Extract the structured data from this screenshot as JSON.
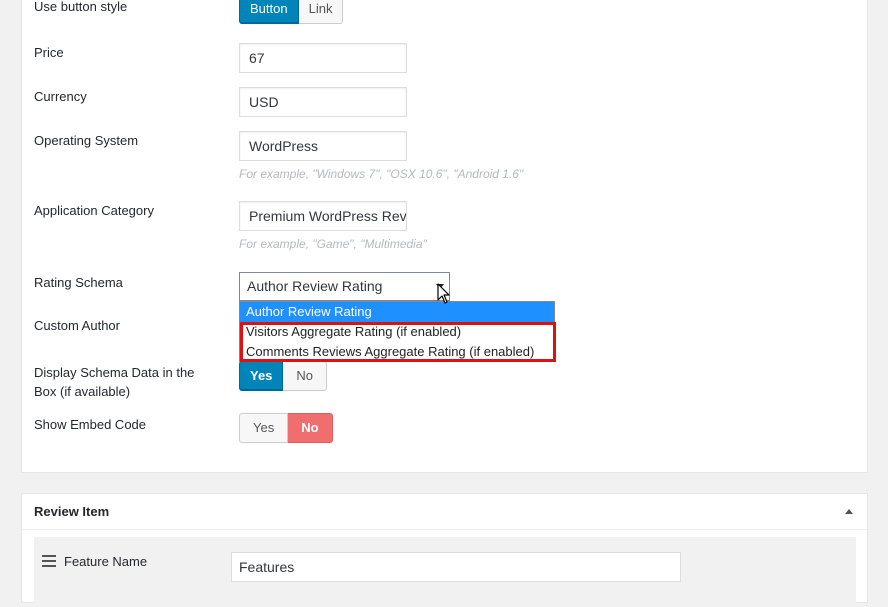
{
  "form": {
    "button_style": {
      "label": "Use button style",
      "options": [
        "Button",
        "Link"
      ],
      "selected": "Button"
    },
    "price": {
      "label": "Price",
      "value": "67"
    },
    "currency": {
      "label": "Currency",
      "value": "USD"
    },
    "operating_system": {
      "label": "Operating System",
      "value": "WordPress",
      "hint": "For example, \"Windows 7\", \"OSX 10.6\", \"Android 1.6\""
    },
    "application_category": {
      "label": "Application Category",
      "value": "Premium WordPress Rev",
      "hint": "For example, \"Game\", \"Multimedia\""
    },
    "rating_schema": {
      "label": "Rating Schema",
      "selected": "Author Review Rating",
      "options": [
        "Author Review Rating",
        "Visitors Aggregate Rating (if enabled)",
        "Comments Reviews Aggregate Rating (if enabled)"
      ]
    },
    "custom_author": {
      "label": "Custom Author"
    },
    "display_schema": {
      "label_line1": "Display Schema Data in the",
      "label_line2": "Box (if available)",
      "options": [
        "Yes",
        "No"
      ],
      "selected": "Yes"
    },
    "show_embed": {
      "label": "Show Embed Code",
      "options": [
        "Yes",
        "No"
      ],
      "selected": "No"
    }
  },
  "review_item": {
    "title": "Review Item",
    "feature_label": "Feature Name",
    "feature_value": "Features"
  },
  "colors": {
    "accent_blue": "#0085ba",
    "accent_red": "#f06e6e",
    "highlight": "#e01010",
    "dropdown_selected": "#1e90ff"
  }
}
